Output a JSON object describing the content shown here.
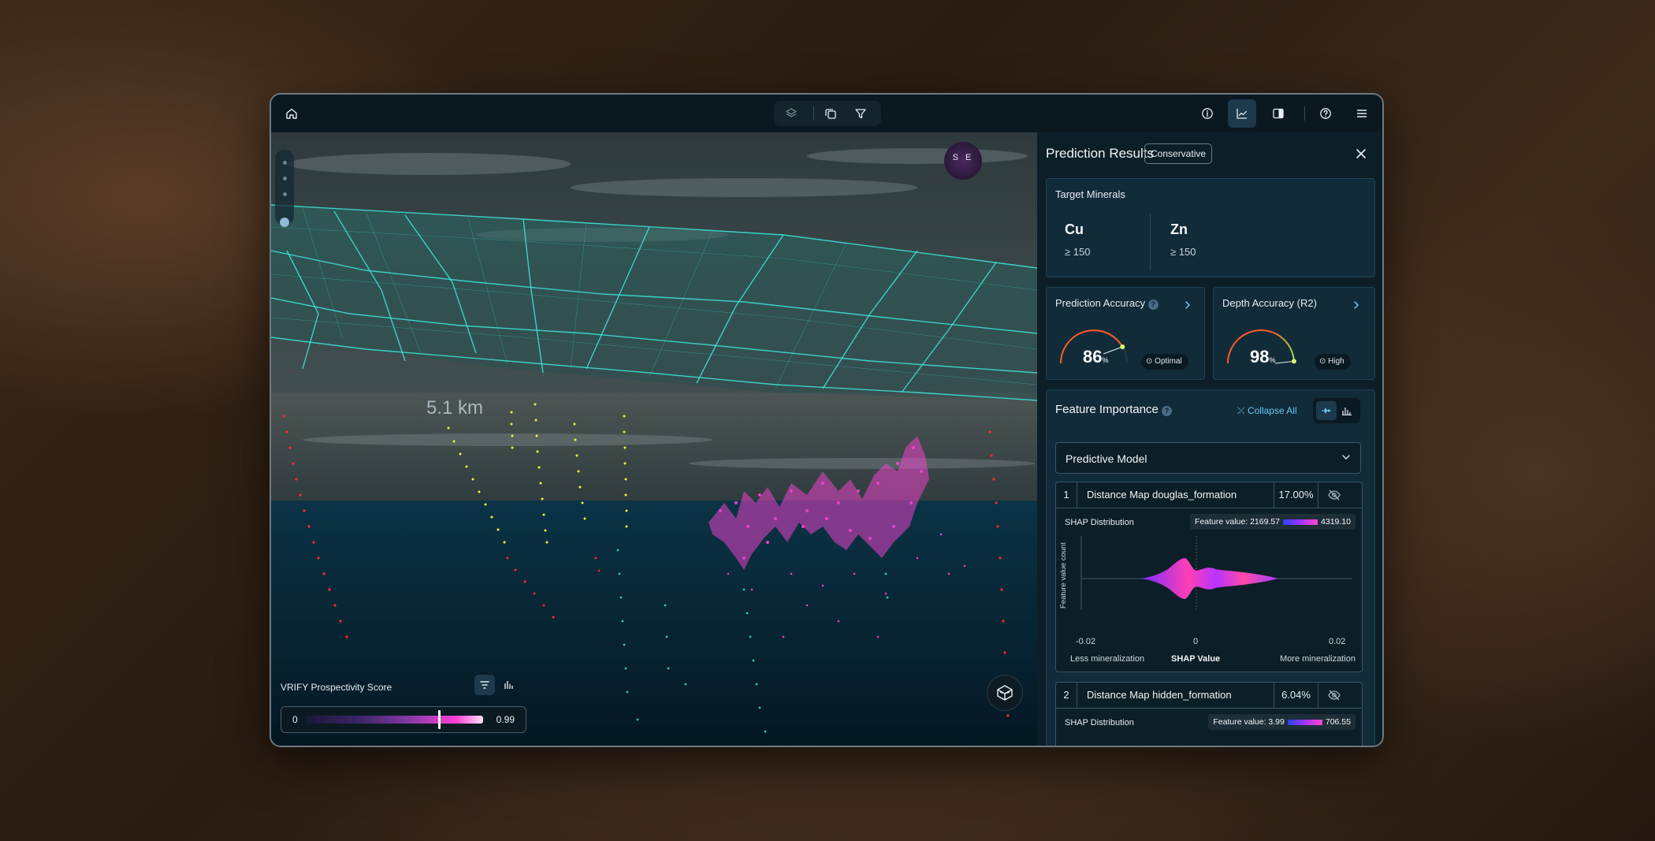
{
  "toolbar": {
    "left": [
      {
        "icon": "home-icon"
      }
    ],
    "center": [
      {
        "icon": "layers-icon"
      },
      {
        "icon": "copy-icon"
      },
      {
        "icon": "filter-icon"
      }
    ],
    "right": [
      {
        "icon": "info-icon"
      },
      {
        "icon": "chart-icon",
        "active": true
      },
      {
        "icon": "panel-icon"
      },
      {
        "icon": "help-icon"
      },
      {
        "icon": "menu-icon"
      }
    ]
  },
  "viewport": {
    "distance_label": "5.1 km",
    "compass_label": "S E",
    "legend": {
      "title": "VRIFY Prospectivity Score",
      "min": "0",
      "max": "0.99",
      "threshold": 0.75,
      "gradient_colors": [
        "#1b1838",
        "#3a2666",
        "#8a3aa8",
        "#ff3fd8",
        "#ffe1f6"
      ]
    },
    "colors": {
      "mesh": "#3ee6dc",
      "drillhole_red": "#ff2a3a",
      "drillhole_yellow": "#f2f23a",
      "drillhole_teal": "#35c9a6",
      "anomaly": "#ff44d8"
    }
  },
  "panel": {
    "title": "Prediction Results",
    "tag": "Conservative",
    "target": {
      "title": "Target Minerals",
      "minerals": [
        {
          "symbol": "Cu",
          "threshold": "≥ 150"
        },
        {
          "symbol": "Zn",
          "threshold": "≥ 150"
        }
      ]
    },
    "prediction_accuracy": {
      "title": "Prediction Accuracy",
      "help": "?",
      "value": "86",
      "unit": "%",
      "badge": "Optimal",
      "fraction": 0.86
    },
    "depth_accuracy": {
      "title": "Depth Accuracy (R2)",
      "value": "98",
      "unit": "%",
      "badge": "High",
      "fraction": 0.98
    },
    "feature_importance": {
      "title": "Feature Importance",
      "help": "?",
      "collapse_label": "Collapse All",
      "model": "Predictive Model",
      "features": [
        {
          "index": "1",
          "name": "Distance Map douglas_formation",
          "pct": "17.00%",
          "shap_label": "SHAP Distribution",
          "fv_prefix": "Feature value: 2169.57",
          "fv_max": "4319.10",
          "y_axis": "Feature value count",
          "x_ticks": [
            "-0.02",
            "0",
            "0.02"
          ],
          "x_label": "SHAP Value",
          "left_label": "Less mineralization",
          "right_label": "More mineralization"
        },
        {
          "index": "2",
          "name": "Distance Map hidden_formation",
          "pct": "6.04%",
          "shap_label": "SHAP Distribution",
          "fv_prefix": "Feature value: 3.99",
          "fv_max": "706.55"
        }
      ]
    }
  }
}
